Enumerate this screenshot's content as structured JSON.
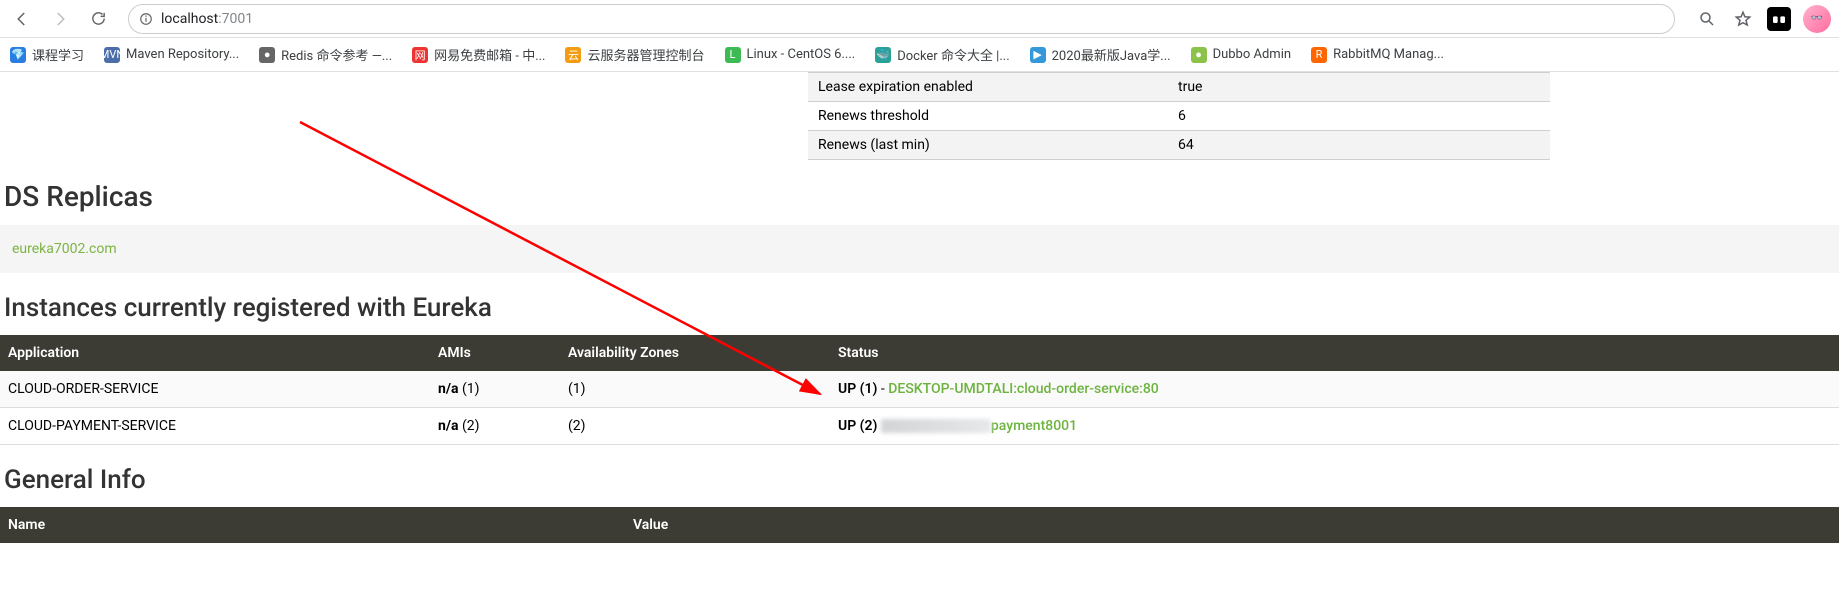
{
  "browser": {
    "url_host": "localhost",
    "url_port": ":7001"
  },
  "bookmarks": [
    {
      "icon_bg": "#2a7de1",
      "icon_txt": "💎",
      "label": "课程学习"
    },
    {
      "icon_bg": "#4b6ea9",
      "icon_txt": "MVN",
      "label": "Maven Repository..."
    },
    {
      "icon_bg": "#666",
      "icon_txt": "●",
      "label": "Redis 命令参考 —..."
    },
    {
      "icon_bg": "#e33",
      "icon_txt": "网",
      "label": "网易免费邮箱 - 中..."
    },
    {
      "icon_bg": "#f39c12",
      "icon_txt": "云",
      "label": "云服务器管理控制台"
    },
    {
      "icon_bg": "#3cba54",
      "icon_txt": "L",
      "label": "Linux - CentOS 6...."
    },
    {
      "icon_bg": "#2aa198",
      "icon_txt": "🐳",
      "label": "Docker 命令大全 |..."
    },
    {
      "icon_bg": "#3498db",
      "icon_txt": "▶",
      "label": "2020最新版Java学..."
    },
    {
      "icon_bg": "#8bc34a",
      "icon_txt": "●",
      "label": "Dubbo Admin"
    },
    {
      "icon_bg": "#ff6600",
      "icon_txt": "R",
      "label": "RabbitMQ Manag..."
    }
  ],
  "top_info": [
    {
      "k": "Lease expiration enabled",
      "v": "true"
    },
    {
      "k": "Renews threshold",
      "v": "6"
    },
    {
      "k": "Renews (last min)",
      "v": "64"
    }
  ],
  "sections": {
    "ds_replicas": "DS Replicas",
    "instances": "Instances currently registered with Eureka",
    "general_info": "General Info"
  },
  "replica_link": "eureka7002.com",
  "inst_headers": {
    "app": "Application",
    "ami": "AMIs",
    "az": "Availability Zones",
    "status": "Status"
  },
  "inst_rows": [
    {
      "app": "CLOUD-ORDER-SERVICE",
      "ami": "n/a (1)",
      "az": "(1)",
      "status_prefix": "UP (1) - ",
      "status_link": "DESKTOP-UMDTALI:cloud-order-service:80",
      "obscured": false
    },
    {
      "app": "CLOUD-PAYMENT-SERVICE",
      "ami": "n/a (2)",
      "az": "(2)",
      "status_prefix": "UP (2) ",
      "status_link": "payment8001",
      "obscured": true
    }
  ],
  "gen_headers": {
    "name": "Name",
    "value": "Value"
  }
}
